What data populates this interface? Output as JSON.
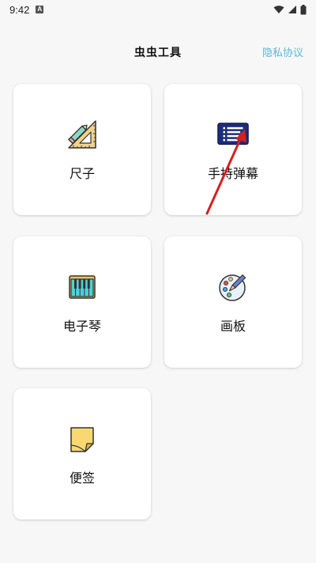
{
  "status_bar": {
    "time": "9:42",
    "notification_icon": "a-badge-icon",
    "icons": [
      "wifi-icon",
      "signal-icon",
      "battery-icon"
    ]
  },
  "header": {
    "title": "虫虫工具",
    "privacy_link": "隐私协议"
  },
  "tools": [
    {
      "label": "尺子",
      "icon": "ruler-icon"
    },
    {
      "label": "手持弹幕",
      "icon": "barrage-icon"
    },
    {
      "label": "电子琴",
      "icon": "piano-icon"
    },
    {
      "label": "画板",
      "icon": "palette-icon"
    },
    {
      "label": "便签",
      "icon": "sticky-note-icon"
    }
  ],
  "colors": {
    "background": "#f7f7f7",
    "card": "#ffffff",
    "link": "#5bb8d6",
    "annotation_arrow": "#d42020"
  }
}
